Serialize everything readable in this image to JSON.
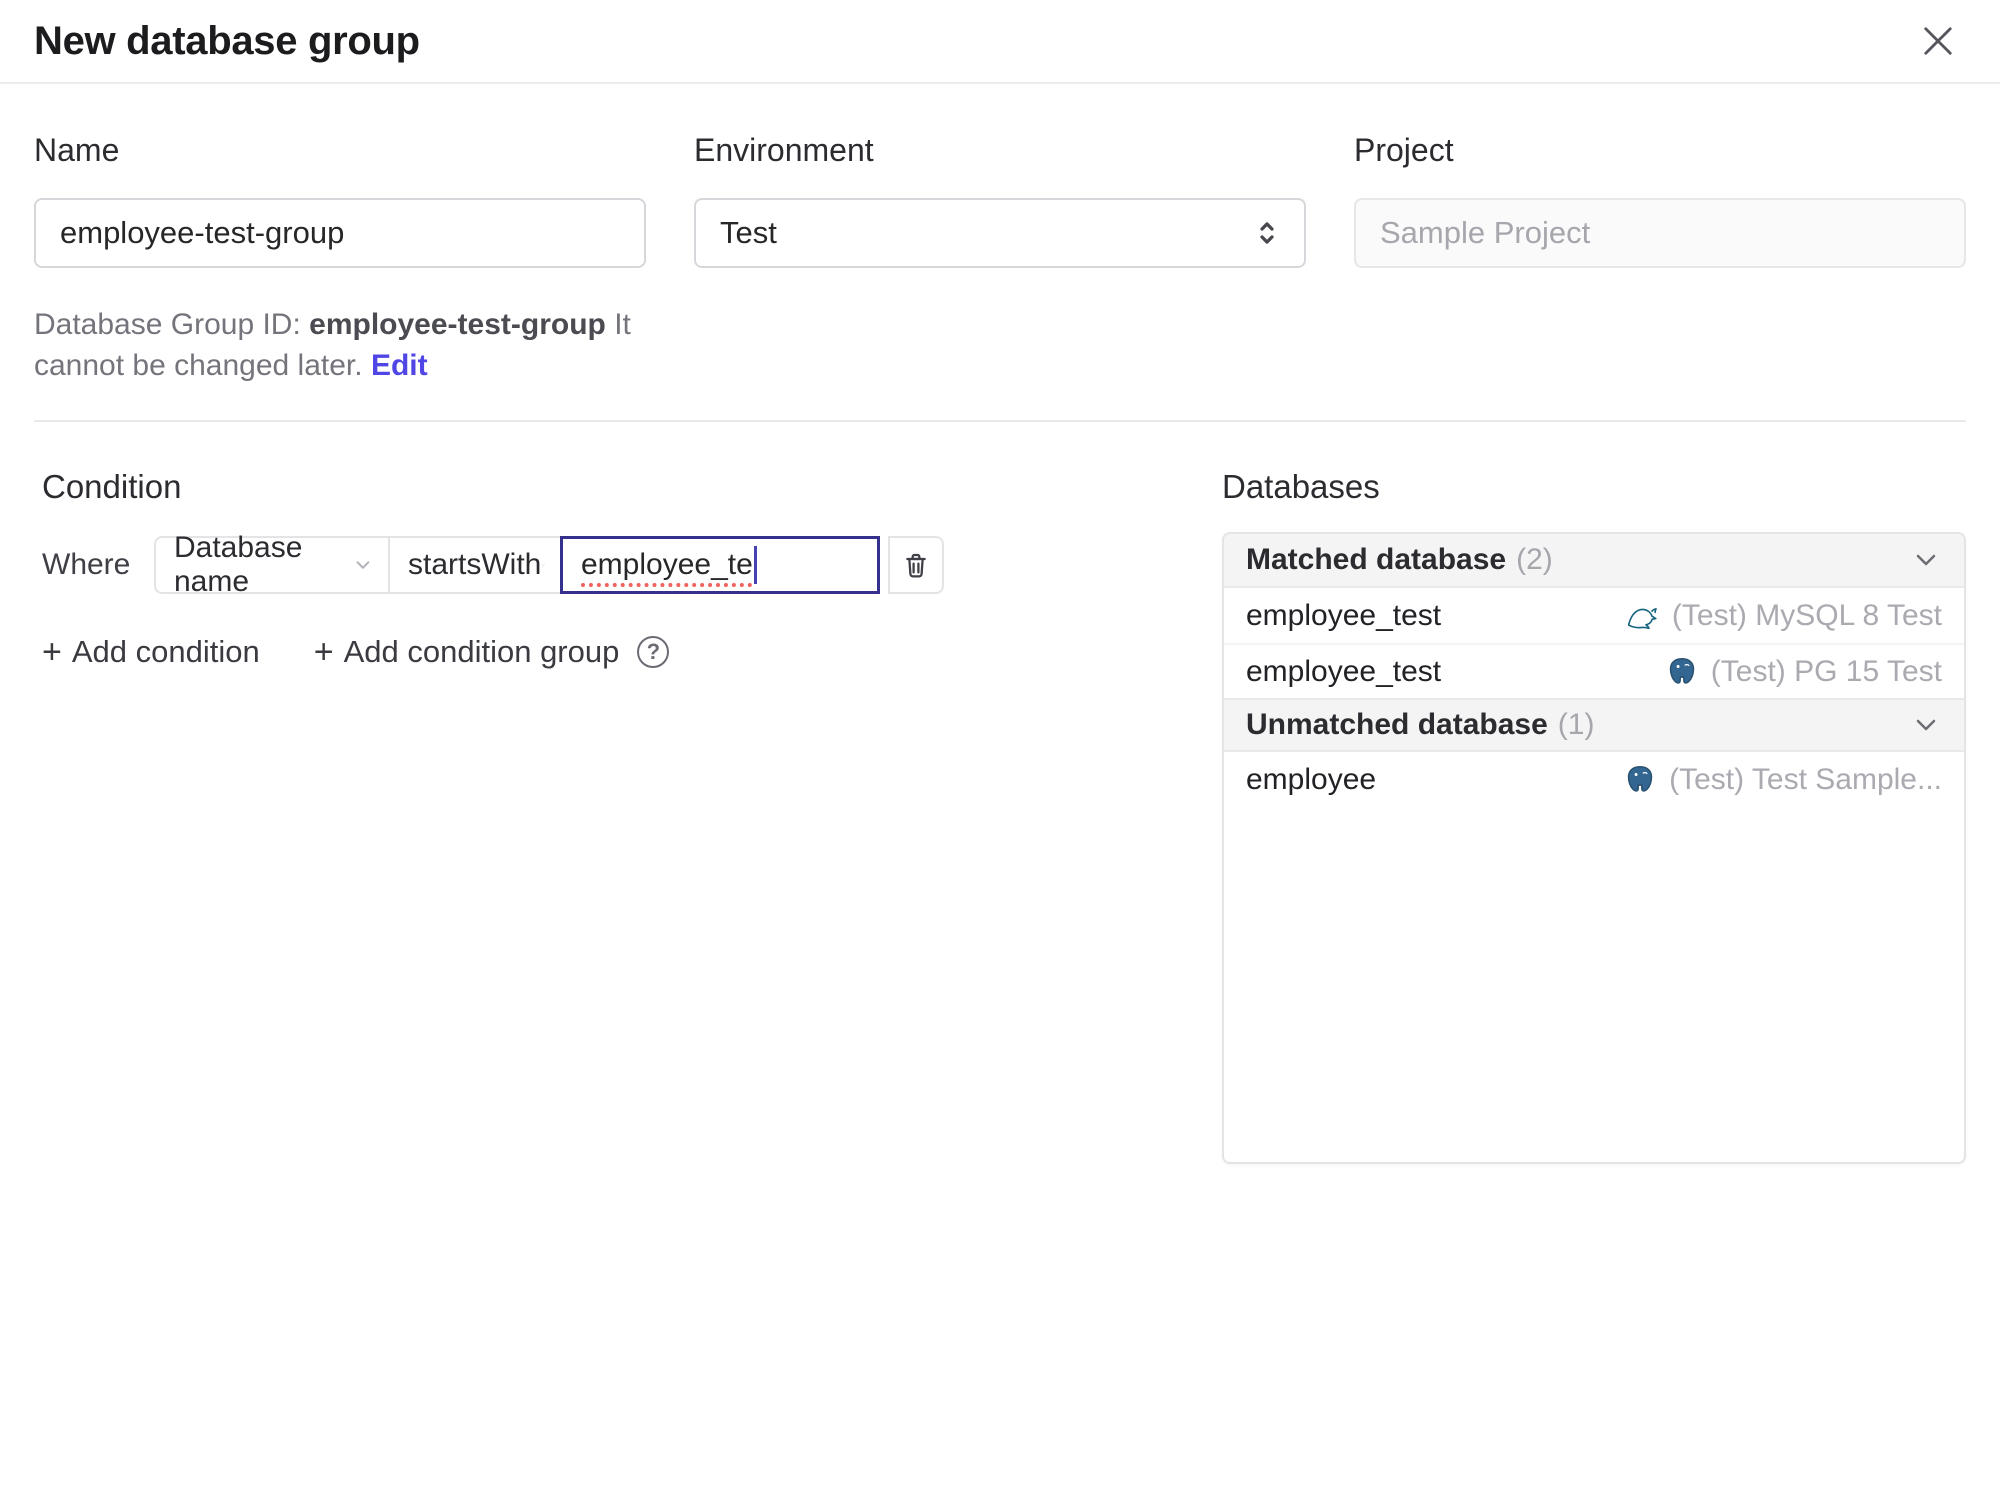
{
  "header": {
    "title": "New database group"
  },
  "form": {
    "name": {
      "label": "Name",
      "value": "employee-test-group"
    },
    "environment": {
      "label": "Environment",
      "value": "Test"
    },
    "project": {
      "label": "Project",
      "value": "Sample Project"
    },
    "helper": {
      "prefix": "Database Group ID: ",
      "id_value": "employee-test-group",
      "suffix": " It cannot be changed later. ",
      "edit_link": "Edit"
    }
  },
  "condition": {
    "heading": "Condition",
    "where_label": "Where",
    "field_selected": "Database name",
    "operator_selected": "startsWith",
    "value": "employee_te",
    "add_condition_label": "Add condition",
    "add_condition_group_label": "Add condition group",
    "plus": "+"
  },
  "databases": {
    "heading": "Databases",
    "matched": {
      "title": "Matched database",
      "count": "(2)",
      "rows": [
        {
          "name": "employee_test",
          "engine": "mysql",
          "instance": "(Test) MySQL 8 Test"
        },
        {
          "name": "employee_test",
          "engine": "postgres",
          "instance": "(Test) PG 15 Test"
        }
      ]
    },
    "unmatched": {
      "title": "Unmatched database",
      "count": "(1)",
      "rows": [
        {
          "name": "employee",
          "engine": "postgres",
          "instance": "(Test) Test Sample..."
        }
      ]
    }
  },
  "colors": {
    "focus_border": "#35308c",
    "link": "#4f46e5",
    "mysql_icon": "#13637c",
    "postgres_icon": "#336791",
    "panel_header_bg": "#f4f4f5",
    "muted_text": "#a6a6ad"
  }
}
